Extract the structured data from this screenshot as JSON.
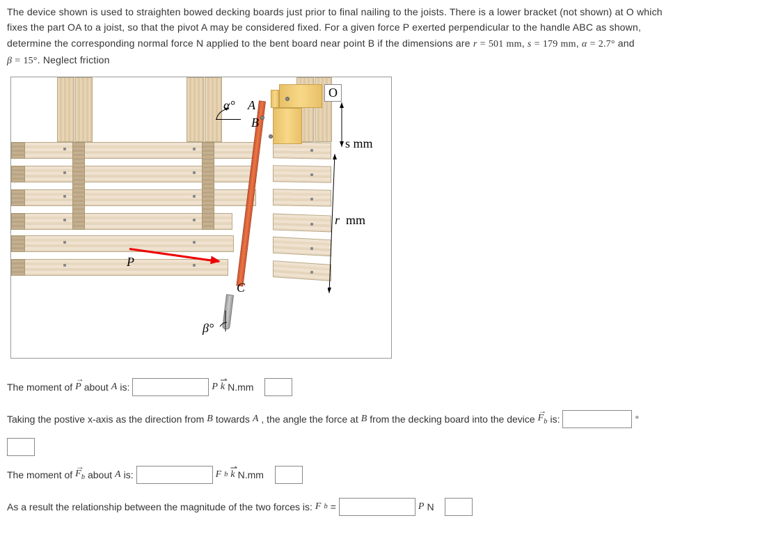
{
  "problem": {
    "p1": "The device shown is used to straighten bowed decking boards just prior to final nailing to the joists. There is a lower bracket (not shown) at O which",
    "p2": "fixes the part OA to a joist, so that the pivot A may be considered fixed. For a given force P exerted perpendicular to the handle ABC as shown,",
    "p3_a": "determine the corresponding normal force N applied to the bent board near point B if the dimensions are ",
    "p3_b": " and",
    "p4_a": ". Neglect friction",
    "r_val": "501",
    "s_val": "179",
    "alpha_val": "2.7°",
    "beta_val": "15°"
  },
  "diagram": {
    "O": "O",
    "A": "A",
    "B": "B",
    "C": "C",
    "P": "P",
    "alpha": "α°",
    "beta": "β°",
    "s_label": "s mm",
    "r_label": "r  mm"
  },
  "q1": {
    "prefix": "The moment of ",
    "P_vec": "P",
    "mid": " about ",
    "A": "A",
    "is": " is:",
    "unit_prefix": "P",
    "unit_k": "k",
    "unit_suffix": " N.mm"
  },
  "q2": {
    "text_a": "Taking the postive x-axis as the direction from ",
    "B": "B",
    "text_b": " towards ",
    "A": "A",
    "text_c": ", the angle the force at ",
    "text_d": " from the decking board into the device ",
    "Fb": "F",
    "sub_b": "b",
    "is": " is:",
    "deg": "°"
  },
  "q3": {
    "prefix": "The moment of ",
    "Fb": "F",
    "sub_b": "b",
    "mid": " about ",
    "A": "A",
    "is": " is:",
    "unit_F": "F",
    "unit_k": "k",
    "unit_suffix": " N.mm"
  },
  "q4": {
    "text": "As a result the relationship between the magnitude of the two forces is: ",
    "Fb": "F",
    "sub_b": "b",
    "eq": " =",
    "P": "P",
    "N": " N"
  }
}
